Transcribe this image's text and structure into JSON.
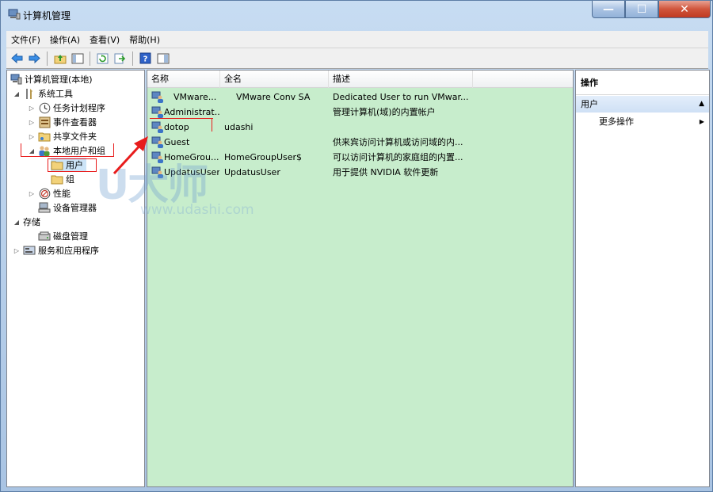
{
  "window": {
    "title": "计算机管理",
    "minimize_glyph": "—",
    "maximize_glyph": "☐",
    "close_glyph": "✕"
  },
  "menu": [
    "文件(F)",
    "操作(A)",
    "查看(V)",
    "帮助(H)"
  ],
  "tree": {
    "root": "计算机管理(本地)",
    "system_tools": "系统工具",
    "task_scheduler": "任务计划程序",
    "event_viewer": "事件查看器",
    "shared_folders": "共享文件夹",
    "local_users_groups": "本地用户和组",
    "users": "用户",
    "groups": "组",
    "performance": "性能",
    "device_manager": "设备管理器",
    "storage": "存储",
    "disk_management": "磁盘管理",
    "services_apps": "服务和应用程序"
  },
  "list": {
    "columns": [
      "名称",
      "全名",
      "描述"
    ],
    "rows": [
      {
        "name": "VMware...",
        "full_name": "VMware Conv SA",
        "description": "Dedicated User to run VMwar..."
      },
      {
        "name": "Administrat...",
        "full_name": "",
        "description": "管理计算机(域)的内置帐户"
      },
      {
        "name": "dotop",
        "full_name": "udashi",
        "description": ""
      },
      {
        "name": "Guest",
        "full_name": "",
        "description": "供来宾访问计算机或访问域的内..."
      },
      {
        "name": "HomeGrou...",
        "full_name": "HomeGroupUser$",
        "description": "可以访问计算机的家庭组的内置..."
      },
      {
        "name": "UpdatusUser",
        "full_name": "UpdatusUser",
        "description": "用于提供 NVIDIA 软件更新"
      }
    ]
  },
  "actions": {
    "title": "操作",
    "section": "用户",
    "more": "更多操作"
  },
  "watermark": {
    "logo": "U大师",
    "url": "www.udashi.com"
  },
  "colors": {
    "list_background": "#c7edcc",
    "highlight": "#e81c1c",
    "window_frame": "#a9c4e3"
  }
}
